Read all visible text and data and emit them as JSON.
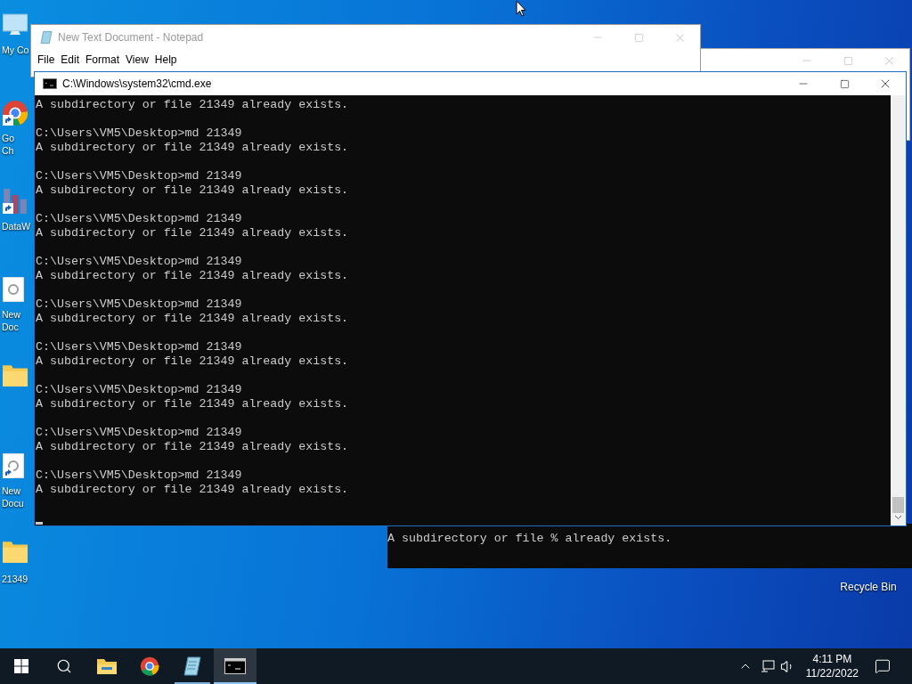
{
  "desktop_icons": [
    {
      "kind": "computer",
      "label_lines": [
        "My Co"
      ],
      "shortcut": false
    },
    {
      "kind": "chrome",
      "label_lines": [
        "Go",
        "Ch"
      ],
      "shortcut": true
    },
    {
      "kind": "app",
      "label_lines": [
        "DataW"
      ],
      "shortcut": true
    },
    {
      "kind": "document",
      "label_lines": [
        "New",
        "Doc"
      ],
      "shortcut": false
    },
    {
      "kind": "folder",
      "shortcut": false
    },
    {
      "kind": "document",
      "label_lines": [
        "New",
        "Docu"
      ],
      "shortcut": true
    },
    {
      "kind": "folder",
      "label_lines": [
        "21349"
      ],
      "shortcut": false
    }
  ],
  "recycle_bin": {
    "label": "Recycle Bin"
  },
  "ghost_console": {
    "text": "A subdirectory or file % already exists."
  },
  "notepad": {
    "title": "New Text Document - Notepad",
    "active": false,
    "menu": [
      "File",
      "Edit",
      "Format",
      "View",
      "Help"
    ]
  },
  "cmd": {
    "title": "C:\\Windows\\system32\\cmd.exe",
    "active": true,
    "first_line": "A subdirectory or file 21349 already exists.",
    "blocks": [
      {
        "prompt": "C:\\Users\\VM5\\Desktop>md 21349",
        "output": "A subdirectory or file 21349 already exists."
      },
      {
        "prompt": "C:\\Users\\VM5\\Desktop>md 21349",
        "output": "A subdirectory or file 21349 already exists."
      },
      {
        "prompt": "C:\\Users\\VM5\\Desktop>md 21349",
        "output": "A subdirectory or file 21349 already exists."
      },
      {
        "prompt": "C:\\Users\\VM5\\Desktop>md 21349",
        "output": "A subdirectory or file 21349 already exists."
      },
      {
        "prompt": "C:\\Users\\VM5\\Desktop>md 21349",
        "output": "A subdirectory or file 21349 already exists."
      },
      {
        "prompt": "C:\\Users\\VM5\\Desktop>md 21349",
        "output": "A subdirectory or file 21349 already exists."
      },
      {
        "prompt": "C:\\Users\\VM5\\Desktop>md 21349",
        "output": "A subdirectory or file 21349 already exists."
      },
      {
        "prompt": "C:\\Users\\VM5\\Desktop>md 21349",
        "output": "A subdirectory or file 21349 already exists."
      },
      {
        "prompt": "C:\\Users\\VM5\\Desktop>md 21349",
        "output": "A subdirectory or file 21349 already exists."
      }
    ]
  },
  "taskbar": {
    "items": [
      {
        "kind": "start",
        "running": false,
        "selected": false
      },
      {
        "kind": "search",
        "running": false,
        "selected": false
      },
      {
        "kind": "explorer",
        "running": false,
        "selected": false
      },
      {
        "kind": "chrome",
        "running": false,
        "selected": false
      },
      {
        "kind": "notepad",
        "running": true,
        "selected": false
      },
      {
        "kind": "cmd",
        "running": true,
        "selected": true
      }
    ],
    "time": "4:11 PM",
    "date": "11/22/2022"
  }
}
